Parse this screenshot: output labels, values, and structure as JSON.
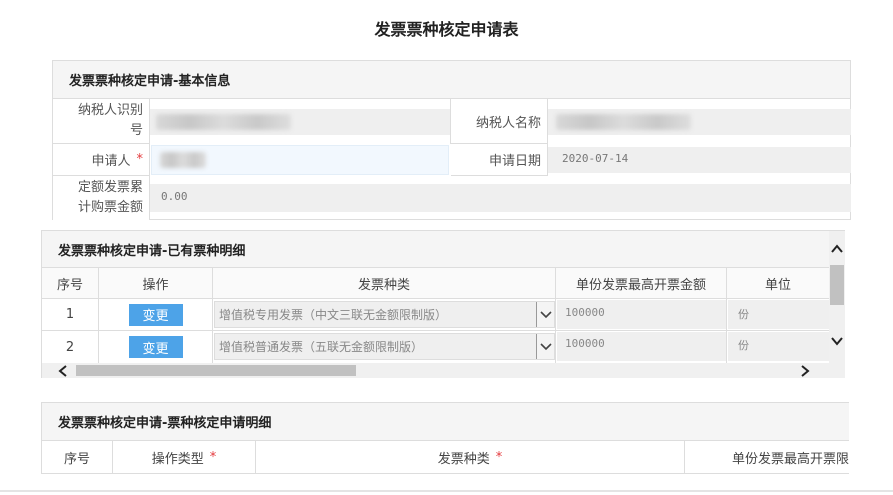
{
  "page_title": "发票票种核定申请表",
  "basic": {
    "header": "发票票种核定申请-基本信息",
    "taxpayer_id_label_1": "纳税人识别",
    "taxpayer_id_label_2": "号",
    "taxpayer_name_label": "纳税人名称",
    "applicant_label": "申请人",
    "required_mark": "*",
    "apply_date_label": "申请日期",
    "apply_date_value": "2020-07-14",
    "quota_label_1": "定额发票累",
    "quota_label_2": "计购票金额",
    "quota_value": "0.00"
  },
  "existing": {
    "header": "发票票种核定申请-已有票种明细",
    "columns": [
      "序号",
      "操作",
      "发票种类",
      "单份发票最高开票金额",
      "单位"
    ],
    "rows": [
      {
        "no": "1",
        "action": "变更",
        "invoice_type": "增值税专用发票（中文三联无金额限制版）",
        "max_amount": "100000",
        "unit": "份"
      },
      {
        "no": "2",
        "action": "变更",
        "invoice_type": "增值税普通发票（五联无金额限制版）",
        "max_amount": "100000",
        "unit": "份"
      }
    ]
  },
  "apply": {
    "header": "发票票种核定申请-票种核定申请明细",
    "columns": [
      "序号",
      "操作类型",
      "发票种类",
      "单份发票最高开票限"
    ],
    "required_mark": "*"
  },
  "icons": {
    "scroll_up": "chevron-up-icon",
    "scroll_down": "chevron-down-icon",
    "scroll_left": "chevron-left-icon",
    "scroll_right": "chevron-right-icon",
    "select_arrow": "chevron-down-icon"
  },
  "colors": {
    "button": "#4da3e8",
    "required": "#e4393c"
  }
}
